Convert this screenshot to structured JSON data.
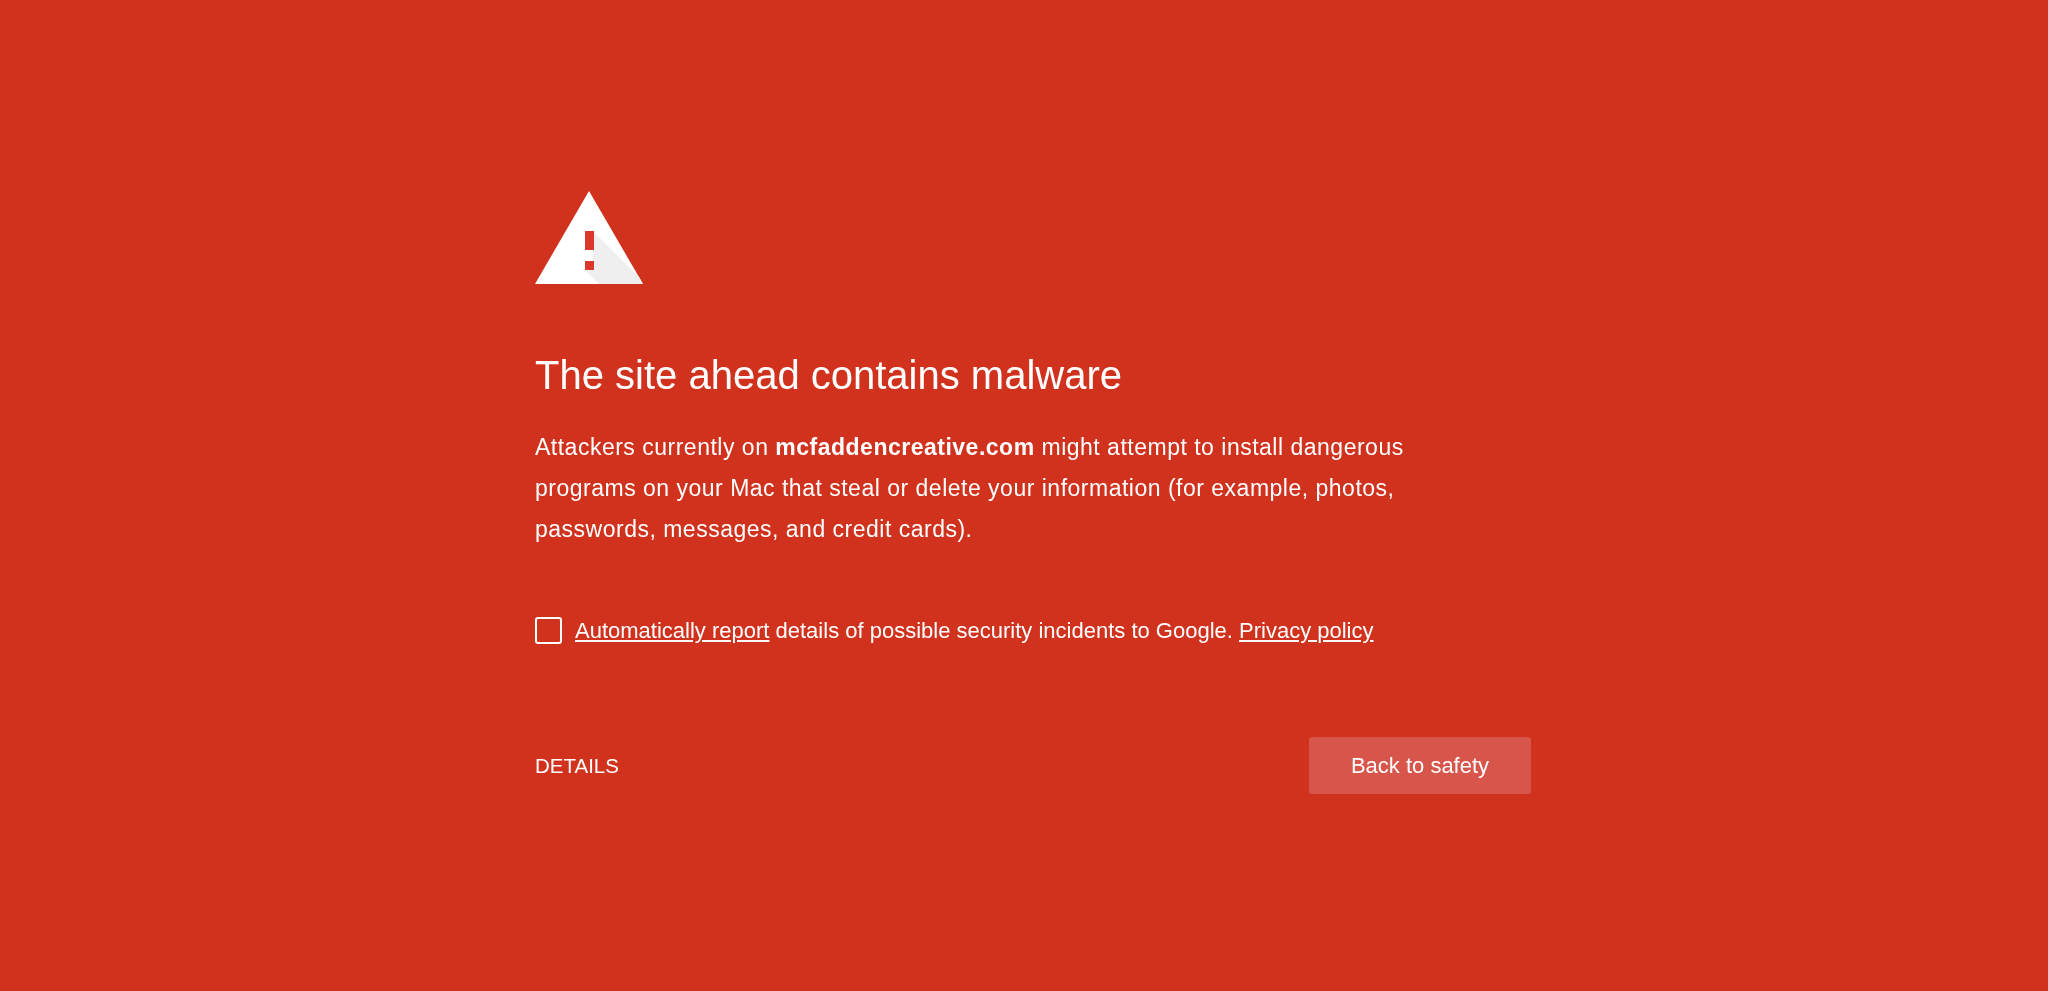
{
  "heading": "The site ahead contains malware",
  "body": "Attackers currently on **mcfaddencreative.com** might attempt to install dangerous programs on your Mac that steal or delete your information (for example, photos, passwords, messages, and credit cards).",
  "report_option": {
    "checked": false,
    "link_text": "Automatically report",
    "text": "details of possible security incidents to Google.",
    "policy_link": "Privacy policy"
  },
  "buttons": [
    {
      "kind": "text",
      "label": "DETAILS"
    },
    {
      "kind": "filled",
      "label": "Back to safety"
    }
  ]
}
